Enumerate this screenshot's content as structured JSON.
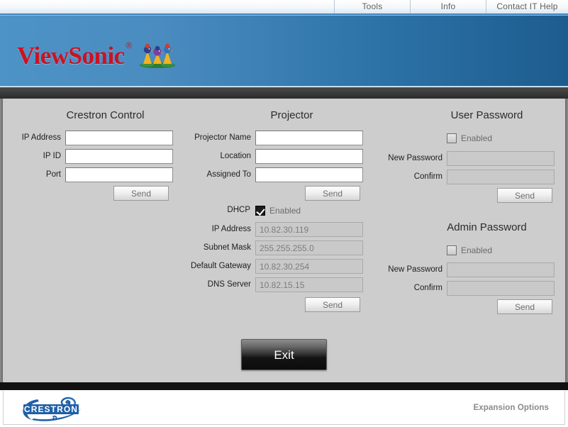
{
  "topnav": {
    "tabs": [
      {
        "label": "Tools",
        "name": "tab-tools"
      },
      {
        "label": "Info",
        "name": "tab-info"
      },
      {
        "label": "Contact IT Help",
        "name": "tab-contact-it-help"
      }
    ]
  },
  "banner": {
    "brand": "ViewSonic",
    "registered_mark": "®",
    "brand_color": "#cc1122",
    "gradient_from": "#4d93c6",
    "gradient_to": "#1d5c8e"
  },
  "crestron_control": {
    "title": "Crestron Control",
    "fields": [
      {
        "label": "IP Address",
        "value": ""
      },
      {
        "label": "IP ID",
        "value": ""
      },
      {
        "label": "Port",
        "value": ""
      }
    ],
    "send_label": "Send"
  },
  "projector": {
    "title": "Projector",
    "fields": [
      {
        "label": "Projector Name",
        "value": ""
      },
      {
        "label": "Location",
        "value": ""
      },
      {
        "label": "Assigned To",
        "value": ""
      }
    ],
    "send_label": "Send",
    "dhcp": {
      "label": "DHCP",
      "checkbox_text": "Enabled",
      "checked": true
    },
    "network_fields": [
      {
        "label": "IP Address",
        "value": "10.82.30.119"
      },
      {
        "label": "Subnet Mask",
        "value": "255.255.255.0"
      },
      {
        "label": "Default Gateway",
        "value": "10.82.30.254"
      },
      {
        "label": "DNS Server",
        "value": "10.82.15.15"
      }
    ],
    "network_send_label": "Send"
  },
  "user_password": {
    "title": "User Password",
    "enabled_text": "Enabled",
    "enabled_checked": false,
    "fields": [
      {
        "label": "New Password",
        "value": ""
      },
      {
        "label": "Confirm",
        "value": ""
      }
    ],
    "send_label": "Send"
  },
  "admin_password": {
    "title": "Admin Password",
    "enabled_text": "Enabled",
    "enabled_checked": false,
    "fields": [
      {
        "label": "New Password",
        "value": ""
      },
      {
        "label": "Confirm",
        "value": ""
      }
    ],
    "send_label": "Send"
  },
  "exit": {
    "label": "Exit"
  },
  "footer": {
    "logo_text": "CRESTRON",
    "expansion_label": "Expansion Options",
    "logo_color": "#1f5fa8"
  }
}
